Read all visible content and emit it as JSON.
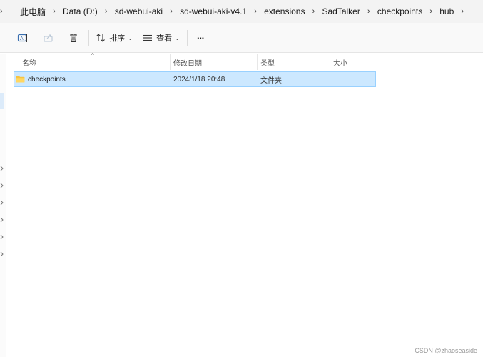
{
  "breadcrumbs": [
    "此电脑",
    "Data (D:)",
    "sd-webui-aki",
    "sd-webui-aki-v4.1",
    "extensions",
    "SadTalker",
    "checkpoints",
    "hub"
  ],
  "toolbar": {
    "sort_label": "排序",
    "view_label": "查看",
    "more_label": "···"
  },
  "columns": {
    "name": "名称",
    "modified": "修改日期",
    "type": "类型",
    "size": "大小"
  },
  "files": [
    {
      "name": "checkpoints",
      "modified": "2024/1/18 20:48",
      "type": "文件夹",
      "size": "",
      "selected": true
    }
  ],
  "watermark": "CSDN @zhaoseaside",
  "colors": {
    "selection_fill": "#cce8ff",
    "selection_border": "#99d1ff",
    "folder": "#f6c342"
  }
}
